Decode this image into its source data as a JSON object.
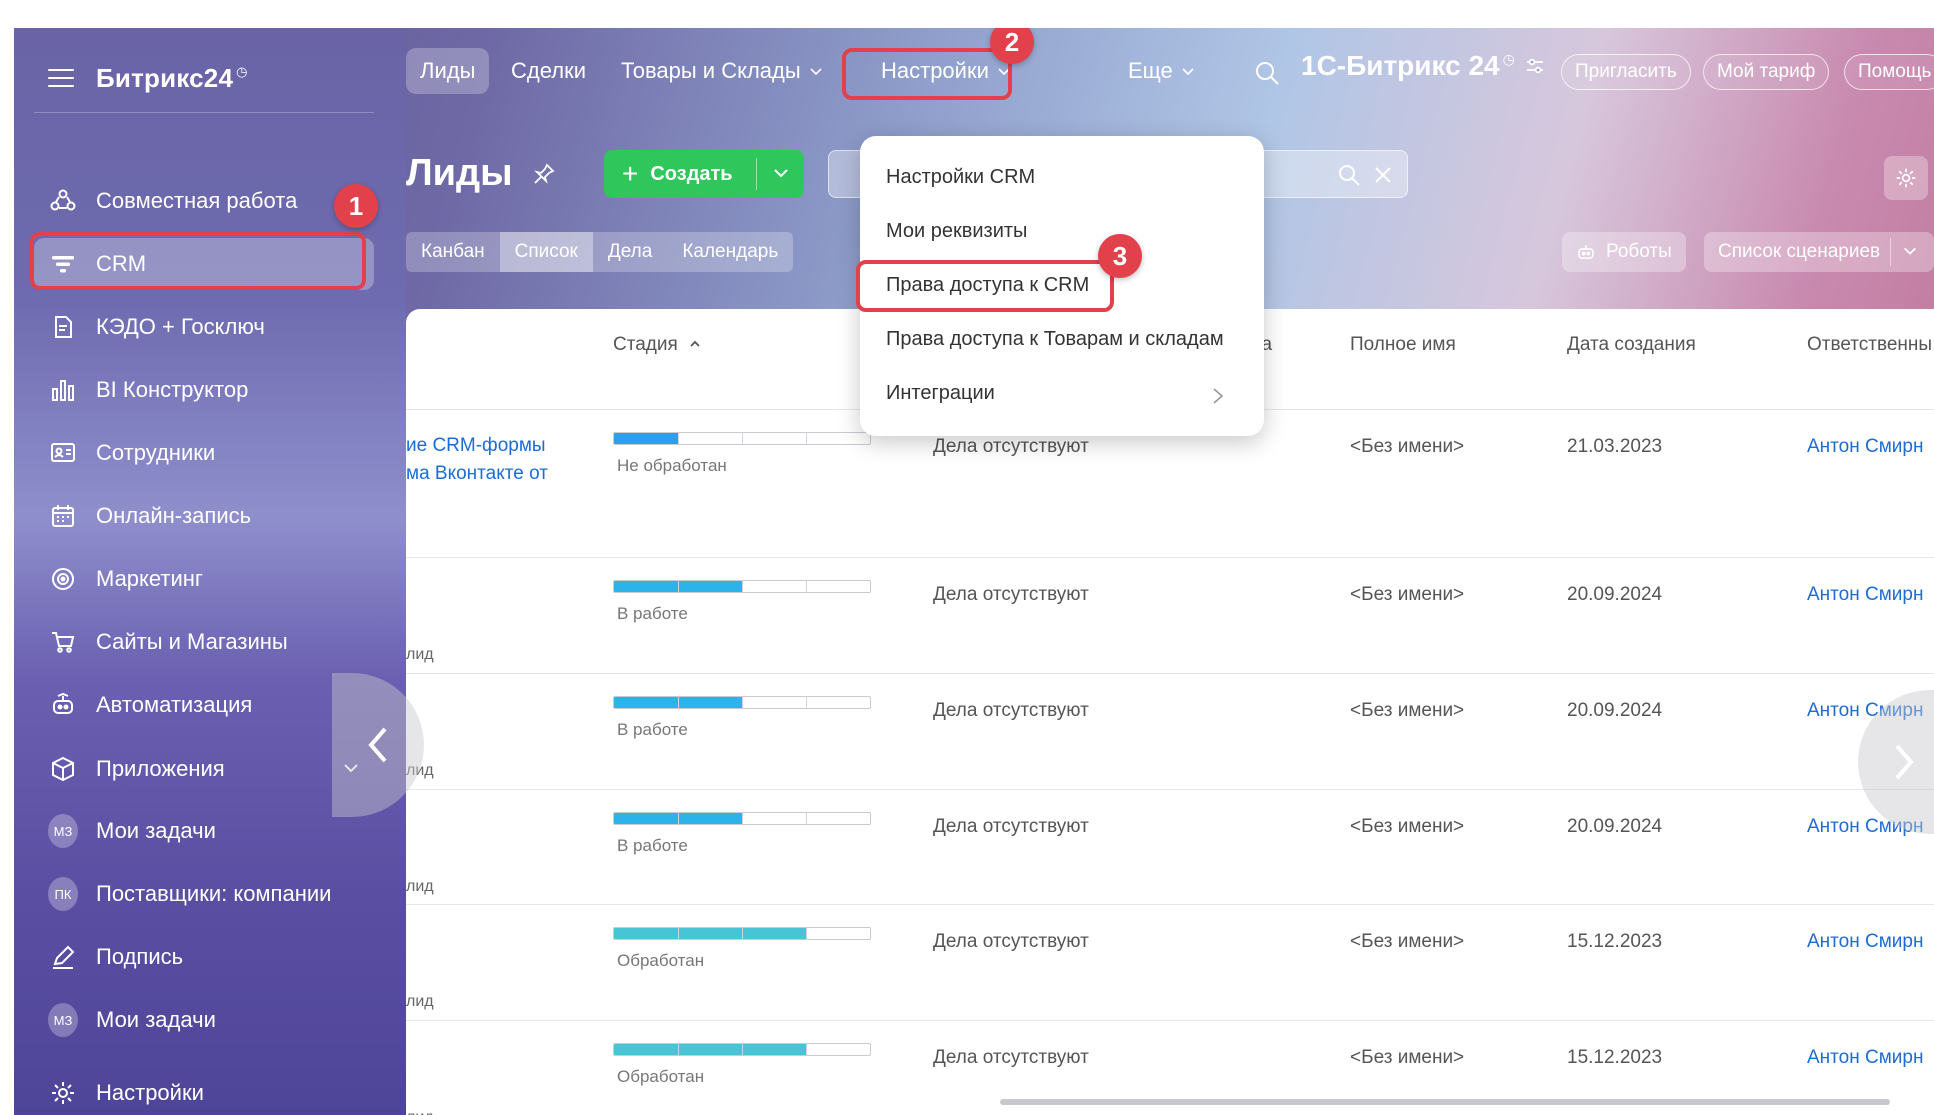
{
  "sidebar": {
    "logo": "Битрикс24",
    "logo_mark": "◷",
    "items": [
      {
        "label": "Совместная работа",
        "icon": "collaboration-icon",
        "chevron": true
      },
      {
        "label": "CRM",
        "icon": "crm-filter-icon",
        "active": true
      },
      {
        "label": "КЭДО + Госключ",
        "icon": "document-icon"
      },
      {
        "label": "BI Конструктор",
        "icon": "bar-chart-icon"
      },
      {
        "label": "Сотрудники",
        "icon": "employees-icon"
      },
      {
        "label": "Онлайн-запись",
        "icon": "calendar-icon"
      },
      {
        "label": "Маркетинг",
        "icon": "marketing-icon"
      },
      {
        "label": "Сайты и Магазины",
        "icon": "cart-icon"
      },
      {
        "label": "Автоматизация",
        "icon": "robot-icon"
      },
      {
        "label": "Приложения",
        "icon": "box-icon",
        "chevron": true
      },
      {
        "label": "Мои задачи",
        "avatar": "МЗ"
      },
      {
        "label": "Поставщики: компании",
        "avatar": "ПК"
      },
      {
        "label": "Подпись",
        "icon": "pen-icon"
      },
      {
        "label": "Мои задачи",
        "avatar": "МЗ"
      },
      {
        "label": "Настройки",
        "icon": "gear-icon"
      }
    ]
  },
  "topnav": {
    "items": [
      "Лиды",
      "Сделки",
      "Товары и Склады",
      "Настройки",
      "Еще"
    ],
    "brand": "1С-Битрикс 24",
    "brand_mark": "◷",
    "buttons": [
      "Пригласить",
      "Мой тариф",
      "Помощь"
    ]
  },
  "toolbar": {
    "title": "Лиды",
    "create_label": "Создать",
    "view_tabs": [
      "Канбан",
      "Список",
      "Дела",
      "Календарь"
    ],
    "robots_label": "Роботы",
    "scenarios_label": "Список сценариев"
  },
  "dropdown": {
    "items": [
      "Настройки CRM",
      "Мои реквизиты",
      "Права доступа к CRM",
      "Права доступа к Товарам и складам",
      "Интеграции"
    ]
  },
  "annotations": {
    "badge1": "1",
    "badge2": "2",
    "badge3": "3"
  },
  "grid": {
    "headers": {
      "stage": "Стадия",
      "activity_tail": "та",
      "fullname": "Полное имя",
      "created": "Дата создания",
      "responsible": "Ответственны"
    },
    "rows": [
      {
        "title": [
          "ие CRM-формы",
          "ма Вконтакте от"
        ],
        "lid": "",
        "stage": "Не обработан",
        "progress": 0.25,
        "color": "#2e9fe8",
        "activity": "Дела отсутствуют",
        "name": "<Без имени>",
        "date": "21.03.2023",
        "responsible": "Антон Смирн"
      },
      {
        "title": [],
        "lid": "лид",
        "stage": "В работе",
        "progress": 0.5,
        "color": "#2bb3ea",
        "activity": "Дела отсутствуют",
        "name": "<Без имени>",
        "date": "20.09.2024",
        "responsible": "Антон Смирн"
      },
      {
        "title": [],
        "lid": "лид",
        "stage": "В работе",
        "progress": 0.5,
        "color": "#2bb3ea",
        "activity": "Дела отсутствуют",
        "name": "<Без имени>",
        "date": "20.09.2024",
        "responsible": "Антон Смирн"
      },
      {
        "title": [],
        "lid": "лид",
        "stage": "В работе",
        "progress": 0.5,
        "color": "#2bb3ea",
        "activity": "Дела отсутствуют",
        "name": "<Без имени>",
        "date": "20.09.2024",
        "responsible": "Антон Смирн"
      },
      {
        "title": [],
        "lid": "лид",
        "stage": "Обработан",
        "progress": 0.75,
        "color": "#47c5d6",
        "activity": "Дела отсутствуют",
        "name": "<Без имени>",
        "date": "15.12.2023",
        "responsible": "Антон Смирн"
      },
      {
        "title": [],
        "lid": "лид",
        "stage": "Обработан",
        "progress": 0.75,
        "color": "#47c5d6",
        "activity": "Дела отсутствуют",
        "name": "<Без имени>",
        "date": "15.12.2023",
        "responsible": "Антон Смирн"
      }
    ]
  },
  "colors": {
    "accent_green": "#2fc65b",
    "highlight_red": "#e2404b",
    "link_blue": "#1c6cd6"
  }
}
